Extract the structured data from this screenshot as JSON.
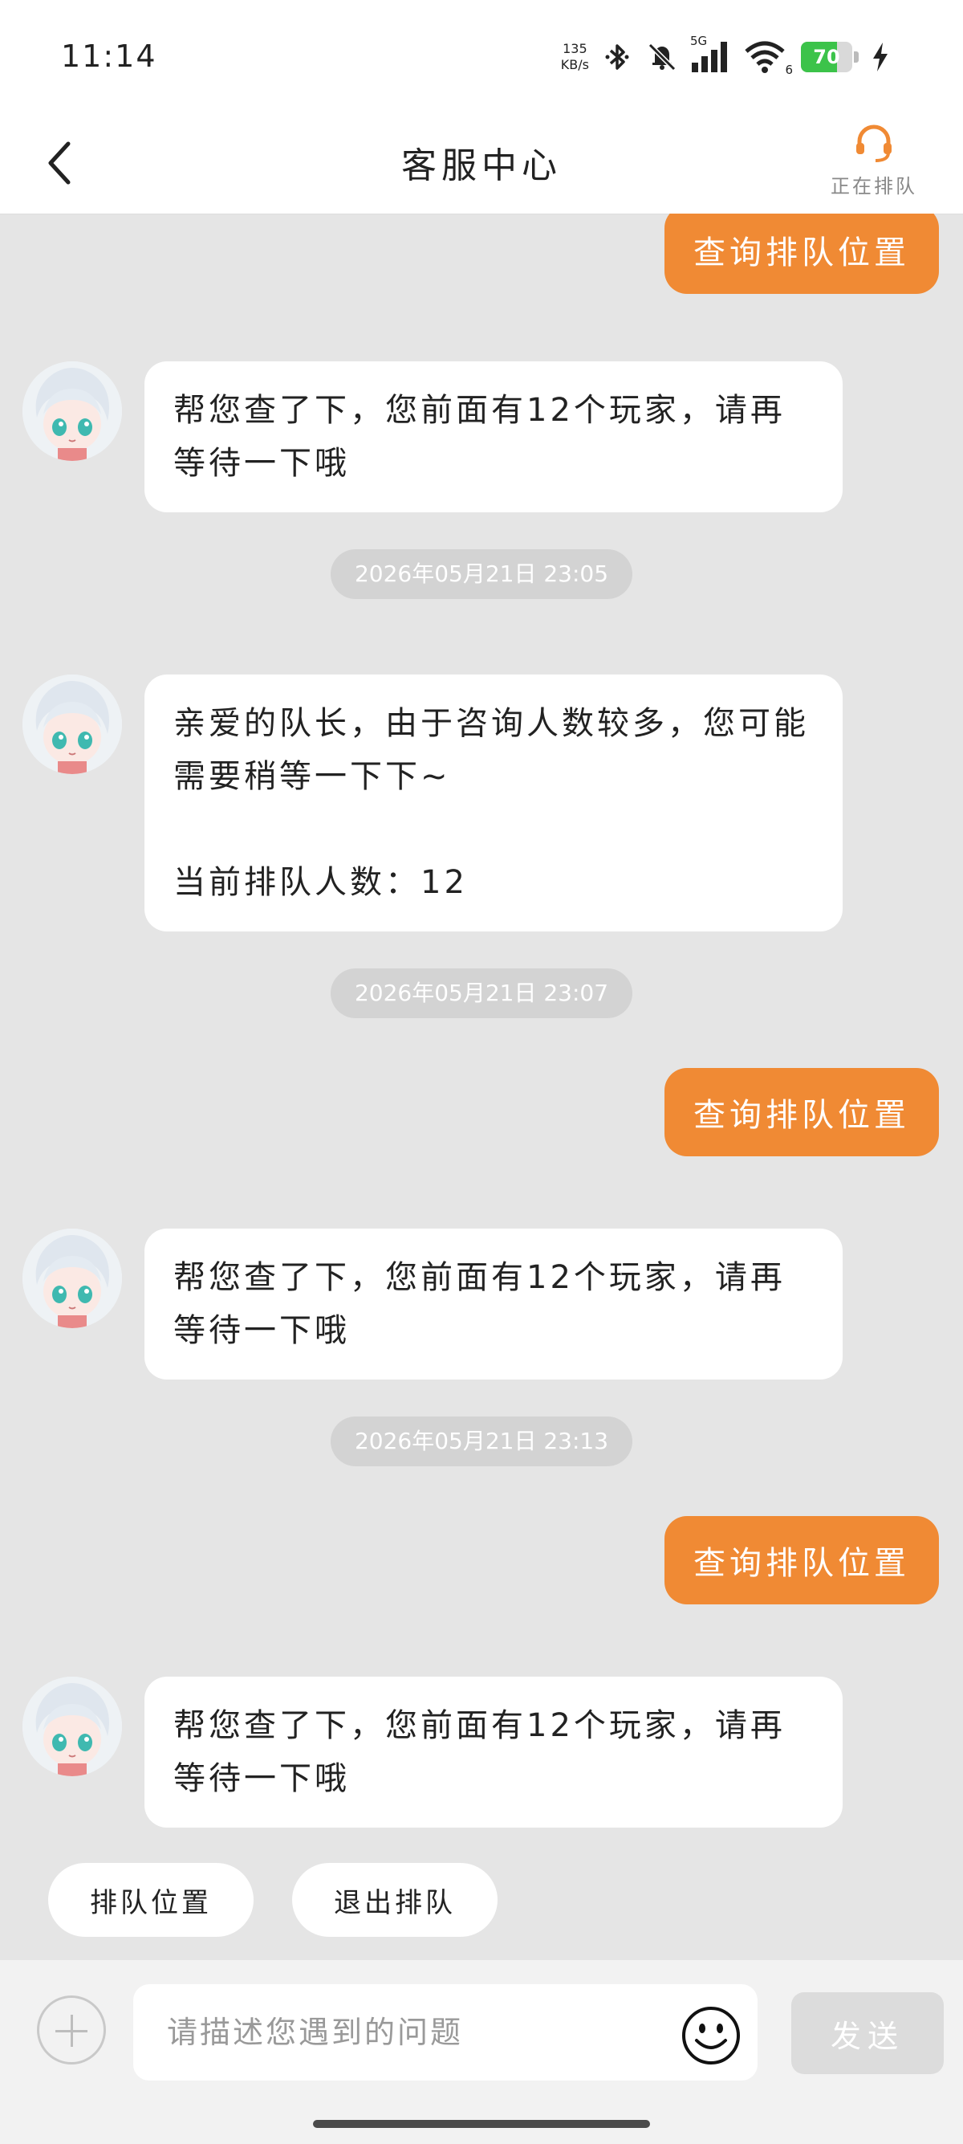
{
  "status_bar": {
    "time": "11:14",
    "net_speed_value": "135",
    "net_speed_unit": "KB/s",
    "network_type": "5G",
    "wifi_level": "6",
    "battery_percent": "70"
  },
  "header": {
    "title": "客服中心",
    "queue_status_label": "正在排队"
  },
  "messages": {
    "out_query_label": "查询排队位置",
    "bot_reply_1": "帮您查了下，您前面有12个玩家，请再等待一下哦",
    "timestamp_1": "2026年05月21日 23:05",
    "bot_notice_line1": "亲爱的队长，由于咨询人数较多，您可能需要稍等一下下~",
    "bot_notice_line2": "当前排队人数：12",
    "timestamp_2": "2026年05月21日 23:07",
    "out_query_2": "查询排队位置",
    "bot_reply_2": "帮您查了下，您前面有12个玩家，请再等待一下哦",
    "timestamp_3": "2026年05月21日 23:13",
    "out_query_3": "查询排队位置",
    "bot_reply_3": "帮您查了下，您前面有12个玩家，请再等待一下哦"
  },
  "quick_actions": {
    "queue_position": "排队位置",
    "exit_queue": "退出排队"
  },
  "composer": {
    "placeholder": "请描述您遇到的问题",
    "send_label": "发送"
  },
  "colors": {
    "accent": "#f08a34",
    "chat_background": "#e5e5e5",
    "battery_green": "#3cc34a"
  },
  "icons": {
    "back": "chevron-left-icon",
    "headset": "headset-icon",
    "bluetooth": "bluetooth-icon",
    "mute": "bell-off-icon",
    "signal": "signal-bars-icon",
    "wifi": "wifi-icon",
    "charging": "bolt-icon",
    "plus": "plus-icon",
    "emoji": "smiley-icon"
  }
}
